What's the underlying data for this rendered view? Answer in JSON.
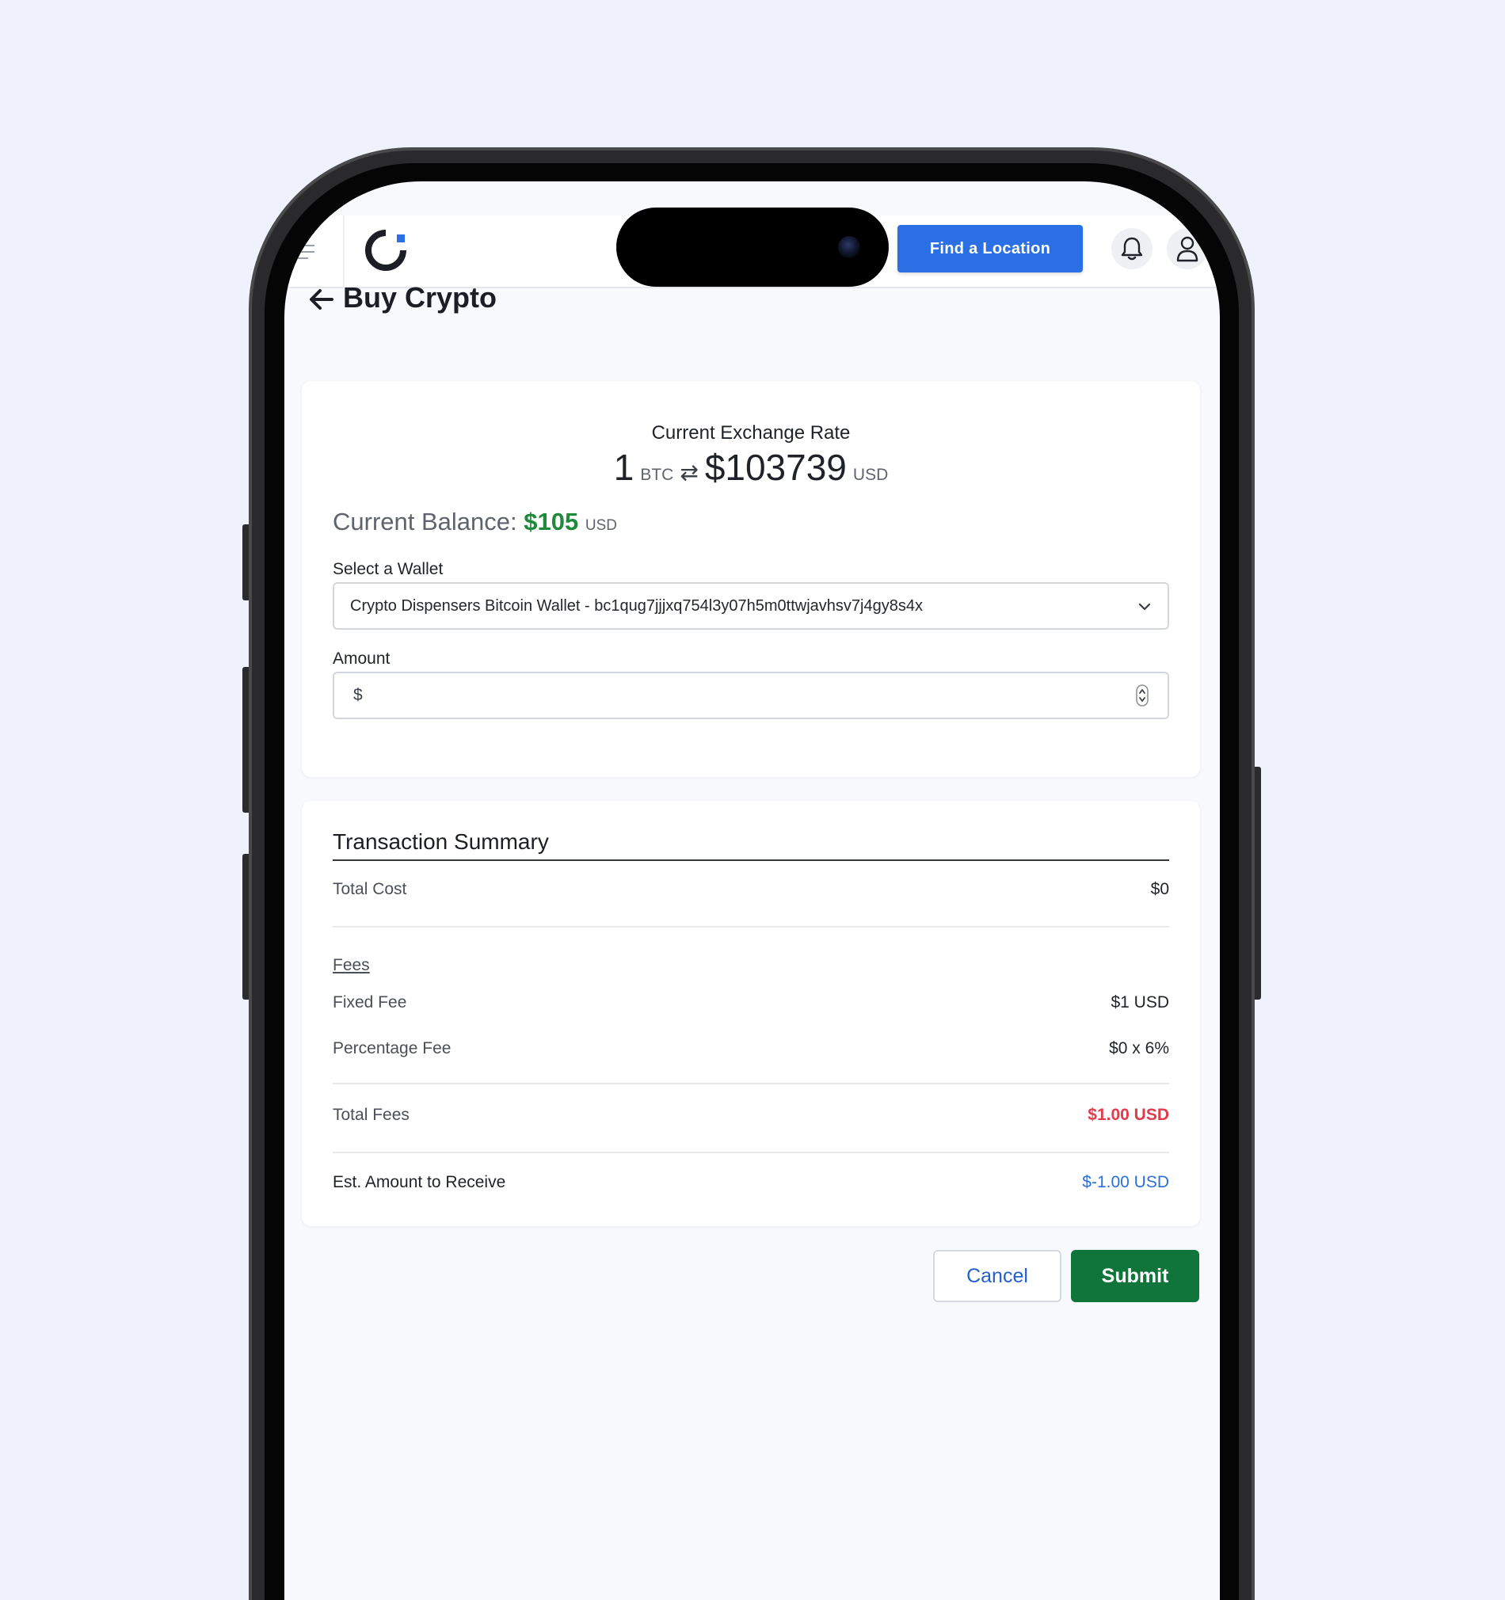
{
  "header": {
    "find_location_label": "Find a Location"
  },
  "page": {
    "title": "Buy Crypto"
  },
  "exchange": {
    "label": "Current Exchange Rate",
    "btc_amount": "1",
    "btc_unit": "BTC",
    "swap_symbol": "⇄",
    "usd_amount": "$103739",
    "usd_unit": "USD"
  },
  "balance": {
    "label": "Current Balance:",
    "amount": "$105",
    "unit": "USD"
  },
  "wallet": {
    "label": "Select a Wallet",
    "selected": "Crypto Dispensers Bitcoin Wallet - bc1qug7jjjxq754l3y07h5m0ttwjavhsv7j4gy8s4x"
  },
  "amount": {
    "label": "Amount",
    "prefix": "$",
    "value": ""
  },
  "summary": {
    "title": "Transaction Summary",
    "total_cost_label": "Total Cost",
    "total_cost_value": "$0",
    "fees_heading": "Fees",
    "fixed_fee_label": "Fixed Fee",
    "fixed_fee_value": "$1 USD",
    "percentage_fee_label": "Percentage Fee",
    "percentage_fee_value": "$0 x 6%",
    "total_fees_label": "Total Fees",
    "total_fees_value": "$1.00 USD",
    "est_receive_label": "Est. Amount to Receive",
    "est_receive_value": "$-1.00 USD"
  },
  "actions": {
    "cancel_label": "Cancel",
    "submit_label": "Submit"
  },
  "colors": {
    "primary_blue": "#2a6fe3",
    "success_green": "#10753a",
    "balance_green": "#1e8a3a",
    "fee_red": "#e23b4c",
    "background": "#eff2fd"
  },
  "icons": {
    "menu": "hamburger-menu-icon",
    "logo": "brand-logo-icon",
    "bell": "bell-icon",
    "user": "user-icon",
    "back": "arrow-left-icon",
    "dropdown": "chevron-down-icon",
    "spinner": "number-spinner-icon"
  }
}
